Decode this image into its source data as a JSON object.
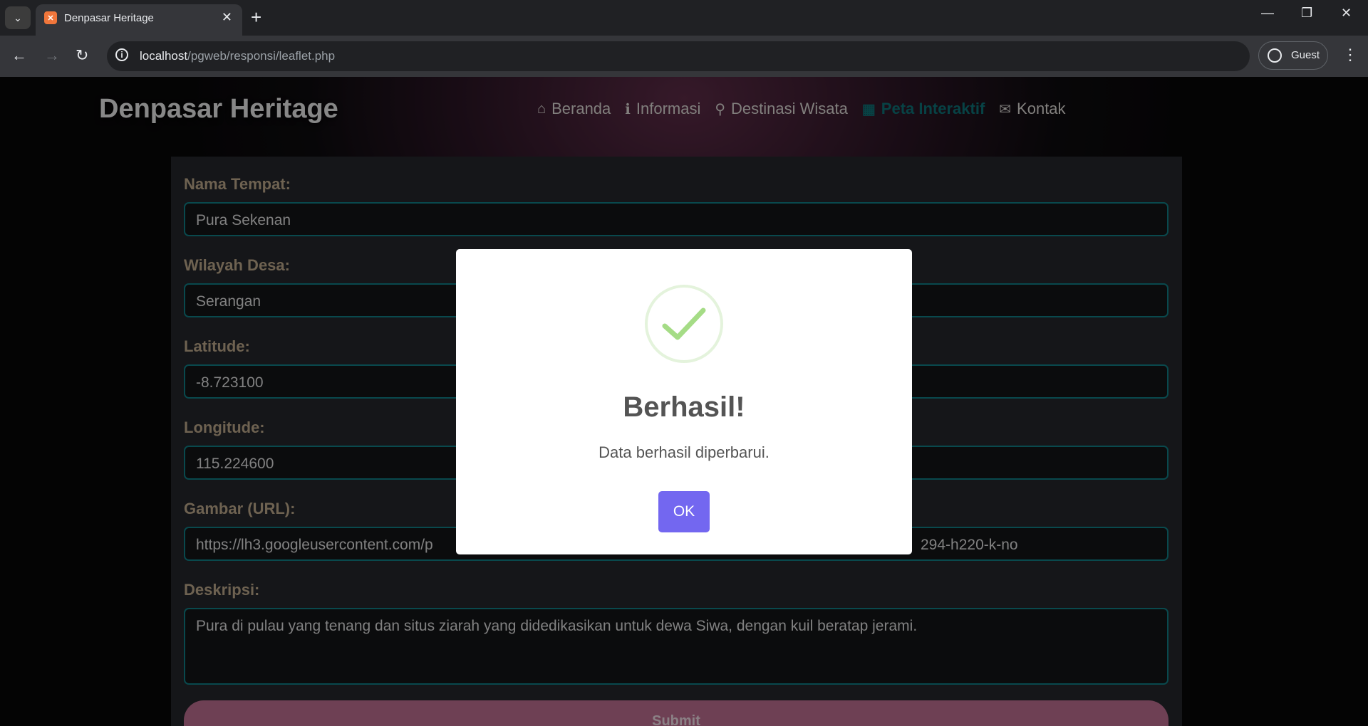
{
  "browser": {
    "tab_title": "Denpasar Heritage",
    "url_host": "localhost",
    "url_path": "/pgweb/responsi/leaflet.php",
    "profile_label": "Guest"
  },
  "site": {
    "brand": "Denpasar Heritage",
    "nav": [
      {
        "label": "Beranda",
        "icon": "home-icon"
      },
      {
        "label": "Informasi",
        "icon": "info-icon"
      },
      {
        "label": "Destinasi Wisata",
        "icon": "map-marker-icon"
      },
      {
        "label": "Peta Interaktif",
        "icon": "map-icon",
        "active": true
      },
      {
        "label": "Kontak",
        "icon": "envelope-icon"
      }
    ]
  },
  "form": {
    "nama_label": "Nama Tempat:",
    "nama_value": "Pura Sekenan",
    "desa_label": "Wilayah Desa:",
    "desa_value": "Serangan",
    "lat_label": "Latitude:",
    "lat_value": "-8.723100",
    "lng_label": "Longitude:",
    "lng_value": "115.224600",
    "gambar_label": "Gambar (URL):",
    "gambar_value_start": "https://lh3.googleusercontent.com/p",
    "gambar_value_end": "294-h220-k-no",
    "desk_label": "Deskripsi:",
    "desk_value": "Pura di pulau yang tenang dan situs ziarah yang didedikasikan untuk dewa Siwa, dengan kuil beratap jerami.",
    "submit_label": "Submit"
  },
  "modal": {
    "title": "Berhasil!",
    "text": "Data berhasil diperbarui.",
    "ok_label": "OK",
    "icon": "success-check-icon"
  },
  "colors": {
    "accent_teal": "#0f7a80",
    "ok_button": "#7367f0",
    "success_check": "#a5dc86",
    "submit_button": "#b76b8c"
  }
}
